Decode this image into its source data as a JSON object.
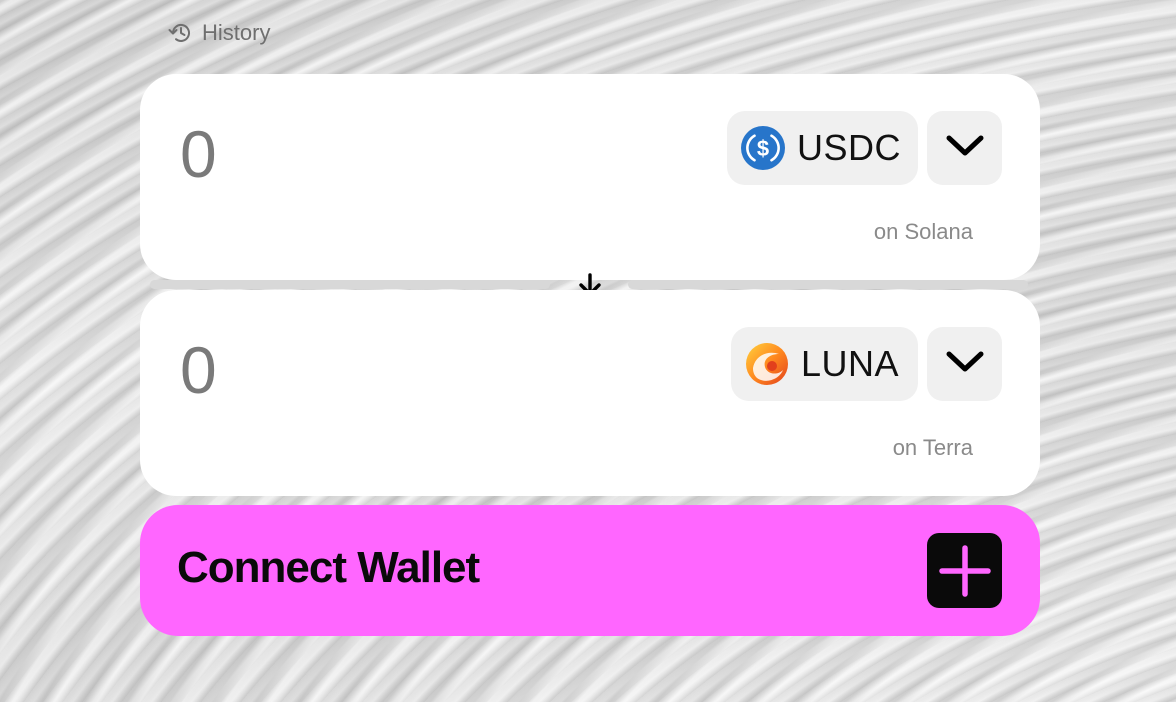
{
  "history": {
    "label": "History",
    "icon": "history-icon"
  },
  "from": {
    "amount": "0",
    "token": "USDC",
    "token_icon": "usdc-icon",
    "network": "on Solana"
  },
  "to": {
    "amount": "0",
    "token": "LUNA",
    "token_icon": "luna-icon",
    "network": "on Terra"
  },
  "swap": {
    "icon": "arrow-down-icon"
  },
  "connect": {
    "label": "Connect Wallet",
    "icon": "plus-icon"
  },
  "colors": {
    "accent": "#ff66ff",
    "usdc": "#2775ca",
    "card": "#ffffff",
    "pill": "#f0f0f0"
  }
}
